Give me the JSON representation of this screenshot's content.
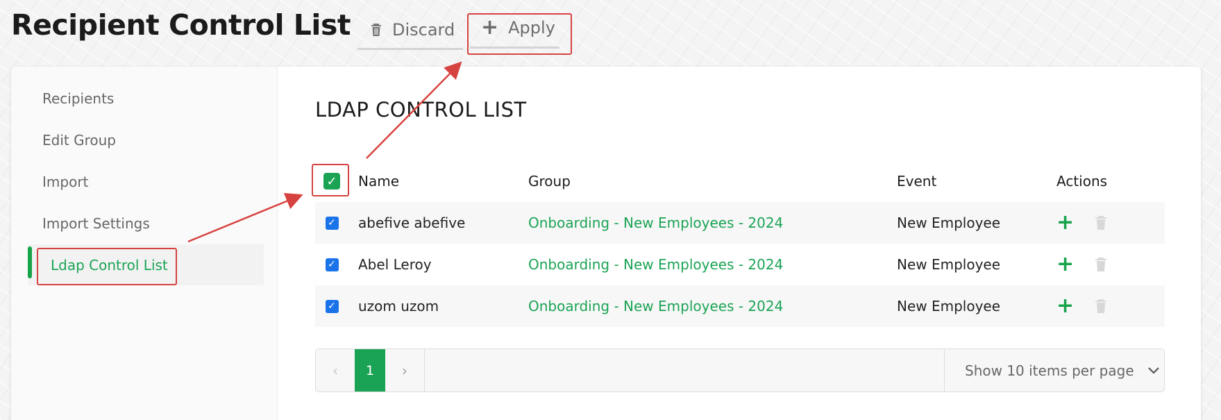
{
  "page": {
    "title": "Recipient Control List"
  },
  "toolbar": {
    "discard_label": "Discard",
    "apply_label": "Apply"
  },
  "sidebar": {
    "items": [
      {
        "label": "Recipients"
      },
      {
        "label": "Edit Group"
      },
      {
        "label": "Import"
      },
      {
        "label": "Import Settings"
      },
      {
        "label": "Ldap Control List",
        "active": true
      }
    ]
  },
  "section": {
    "title": "LDAP CONTROL LIST"
  },
  "table": {
    "headers": {
      "name": "Name",
      "group": "Group",
      "event": "Event",
      "actions": "Actions"
    },
    "select_all_checked": true,
    "rows": [
      {
        "checked": true,
        "name": "abefive abefive",
        "group": "Onboarding - New Employees - 2024",
        "event": "New Employee"
      },
      {
        "checked": true,
        "name": "Abel Leroy",
        "group": "Onboarding - New Employees - 2024",
        "event": "New Employee"
      },
      {
        "checked": true,
        "name": "uzom uzom",
        "group": "Onboarding - New Employees - 2024",
        "event": "New Employee"
      }
    ]
  },
  "pagination": {
    "current_page": "1",
    "page_size_label": "Show 10 items per page"
  },
  "colors": {
    "accent_green": "#1aa354",
    "annotation_red": "#d6423f",
    "checkbox_blue": "#1a73e8"
  },
  "icons": {
    "discard": "trash-icon",
    "apply": "plus-icon",
    "row_add": "plus-icon",
    "row_delete": "trash-icon",
    "prev": "chevron-left-icon",
    "next": "chevron-right-icon",
    "dropdown": "chevron-down-icon"
  }
}
